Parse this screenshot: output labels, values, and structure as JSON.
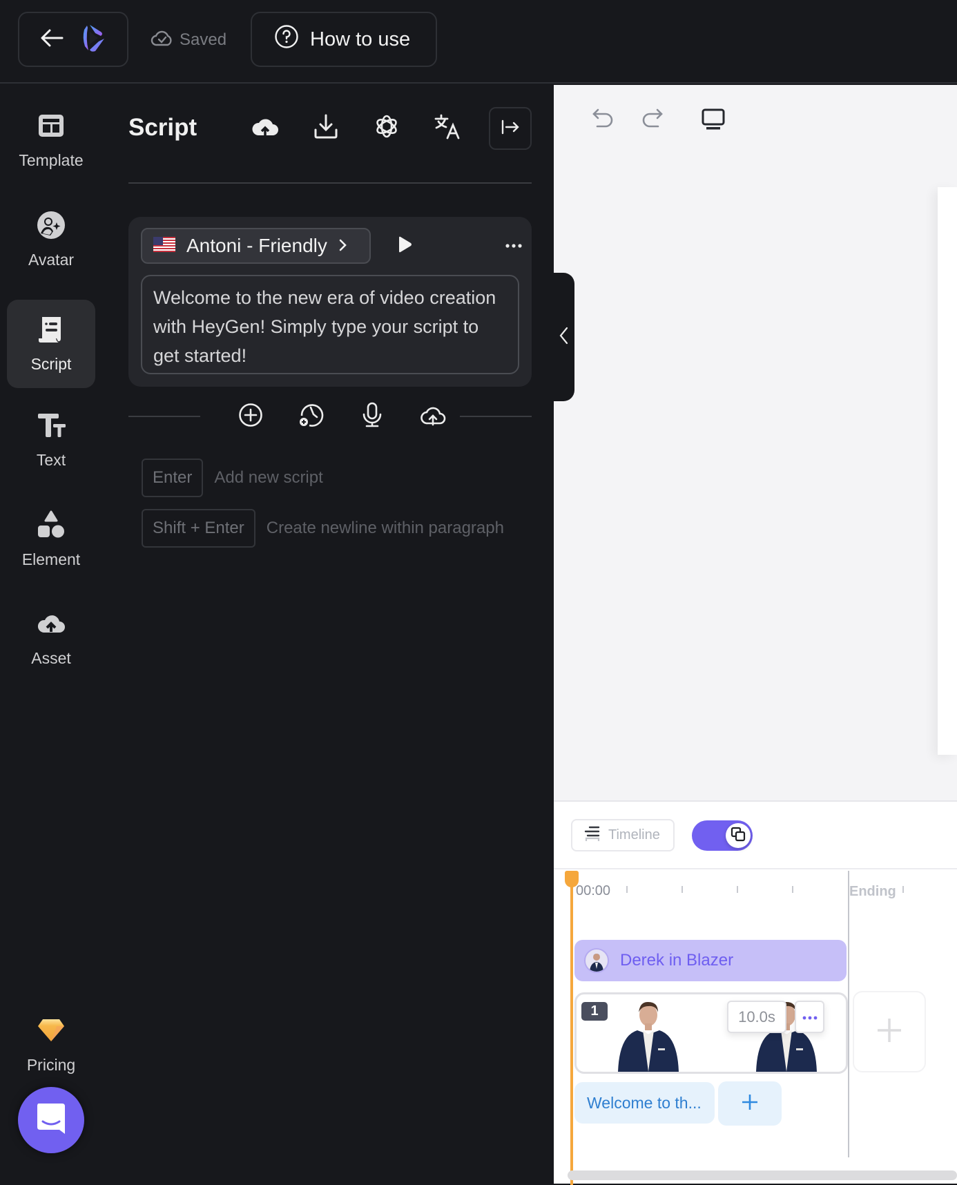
{
  "topbar": {
    "saved_label": "Saved",
    "how_to_use_label": "How to use"
  },
  "nav": {
    "items": [
      {
        "label": "Template",
        "icon": "template-icon"
      },
      {
        "label": "Avatar",
        "icon": "avatar-icon"
      },
      {
        "label": "Script",
        "icon": "script-icon",
        "active": true
      },
      {
        "label": "Text",
        "icon": "text-icon"
      },
      {
        "label": "Element",
        "icon": "element-icon"
      },
      {
        "label": "Asset",
        "icon": "asset-icon"
      }
    ],
    "pricing_label": "Pricing"
  },
  "script_panel": {
    "title": "Script",
    "voice": {
      "flag": "us-flag",
      "name": "Antoni - Friendly"
    },
    "script_text": "Welcome to the new era of video creation with HeyGen! Simply type your script to get started!",
    "hints": [
      {
        "key": "Enter",
        "text": "Add new script"
      },
      {
        "key": "Shift + Enter",
        "text": "Create newline within paragraph"
      }
    ]
  },
  "timeline": {
    "timeline_button_label": "Timeline",
    "view_toggle_on": true,
    "start_time": "00:00",
    "ending_label": "Ending",
    "avatar_track_label": "Derek in Blazer",
    "scene_number": "1",
    "scene_duration": "10.0s",
    "text_clip_label": "Welcome to th..."
  },
  "colors": {
    "accent": "#7160f0",
    "playhead": "#f5a73c",
    "avatar_track_bg": "#c6bff8",
    "text_clip_bg": "#e6f2fc",
    "text_clip_fg": "#2f7fd0",
    "dark_bg": "#17181c"
  }
}
